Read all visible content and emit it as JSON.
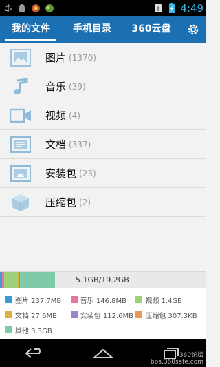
{
  "status_bar": {
    "time": "4:49",
    "battery_icon": "battery-charging-icon",
    "notification_icons": [
      "usb-icon",
      "android-icon",
      "app-icon",
      "app-icon-2"
    ]
  },
  "tabs": [
    {
      "label": "我的文件",
      "active": true
    },
    {
      "label": "手机目录",
      "active": false
    },
    {
      "label": "360云盘",
      "active": false
    }
  ],
  "categories": [
    {
      "label": "图片",
      "count": "(1370)",
      "icon": "image-icon"
    },
    {
      "label": "音乐",
      "count": "(39)",
      "icon": "music-icon"
    },
    {
      "label": "视频",
      "count": "(4)",
      "icon": "video-icon"
    },
    {
      "label": "文档",
      "count": "(337)",
      "icon": "document-icon"
    },
    {
      "label": "安装包",
      "count": "(23)",
      "icon": "package-icon"
    },
    {
      "label": "压缩包",
      "count": "(2)",
      "icon": "archive-icon"
    }
  ],
  "storage": {
    "usage_text": "5.1GB/19.2GB",
    "used_gb": 5.1,
    "total_gb": 19.2
  },
  "legend": [
    {
      "label": "图片 237.7MB",
      "color": "#3a9ad9"
    },
    {
      "label": "音乐 146.8MB",
      "color": "#e8769b"
    },
    {
      "label": "视频 1.4GB",
      "color": "#9ed07a"
    },
    {
      "label": "文档 27.6MB",
      "color": "#d8b342"
    },
    {
      "label": "安装包 112.6MB",
      "color": "#9a86cc"
    },
    {
      "label": "压缩包 307.3KB",
      "color": "#e89a5c"
    },
    {
      "label": "其他 3.3GB",
      "color": "#7fc9a6"
    }
  ],
  "watermark": {
    "line1": "360论坛",
    "line2": "bbs.360safe.com"
  }
}
